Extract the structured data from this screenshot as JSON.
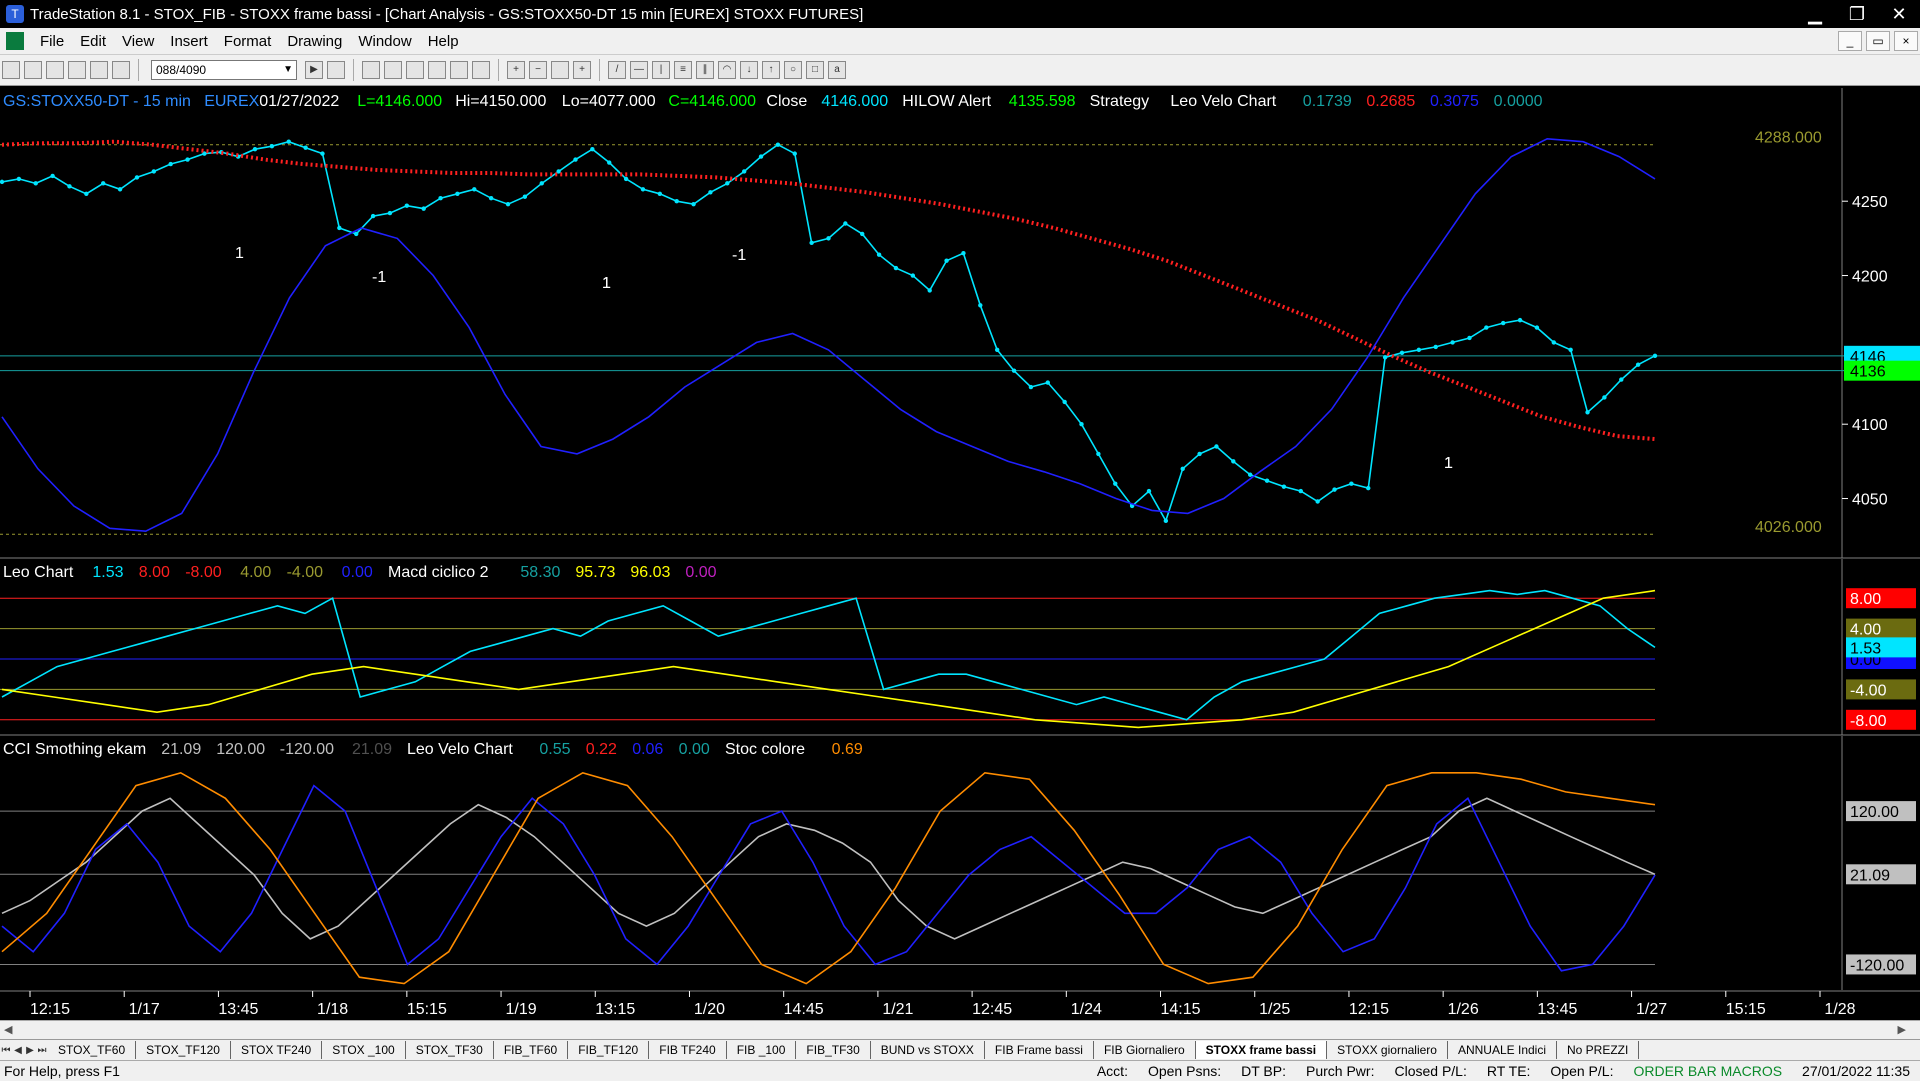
{
  "window": {
    "title": "TradeStation 8.1 - STOX_FIB - STOXX frame bassi - [Chart Analysis - GS:STOXX50-DT  15 min  [EUREX] STOXX FUTURES]",
    "minimize": "▁",
    "restore": "❐",
    "close": "✕"
  },
  "menu": {
    "items": [
      "File",
      "Edit",
      "View",
      "Insert",
      "Format",
      "Drawing",
      "Window",
      "Help"
    ]
  },
  "toolbar": {
    "symbol_combo": "088/4090"
  },
  "chart_data": [
    {
      "type": "line",
      "panel": "price",
      "header": [
        {
          "text": "GS:STOXX50-DT - 15 min",
          "color": "#2f8cff"
        },
        {
          "text": "EUREX",
          "color": "#2f8cff"
        },
        {
          "text": "01/27/2022",
          "color": "#ffffff"
        },
        {
          "text": "L=4146.000",
          "color": "#00ff00"
        },
        {
          "text": "Hi=4150.000",
          "color": "#ffffff"
        },
        {
          "text": "Lo=4077.000",
          "color": "#ffffff"
        },
        {
          "text": "C=4146.000",
          "color": "#00ff00"
        },
        {
          "text": "Close",
          "color": "#ffffff"
        },
        {
          "text": "4146.000",
          "color": "#00e5ff"
        },
        {
          "text": "HILOW Alert",
          "color": "#ffffff"
        },
        {
          "text": "4135.598",
          "color": "#00ff00"
        },
        {
          "text": "Strategy",
          "color": "#ffffff"
        },
        {
          "text": "Leo Velo Chart",
          "color": "#ffffff"
        },
        {
          "text": "0.1739",
          "color": "#16a0a0"
        },
        {
          "text": "0.2685",
          "color": "#ff2020"
        },
        {
          "text": "0.3075",
          "color": "#2020ff"
        },
        {
          "text": "0.0000",
          "color": "#16a0a0"
        }
      ],
      "ylim": [
        4010,
        4310
      ],
      "y_ticks": [
        "4250",
        "4200",
        "4100",
        "4050"
      ],
      "levels": [
        {
          "label": "4288.000",
          "value": 4288,
          "color": "#9a9a30"
        },
        {
          "label": "4026.000",
          "value": 4026,
          "color": "#9a9a30"
        }
      ],
      "last_price_labels": [
        {
          "label": "4146",
          "value": 4146,
          "color": "#00e5ff"
        },
        {
          "label": "4136",
          "value": 4136,
          "color": "#00ff00"
        }
      ],
      "series": [
        {
          "name": "Close",
          "color": "#00e5ff",
          "values": [
            4263,
            4265,
            4262,
            4267,
            4260,
            4255,
            4262,
            4258,
            4266,
            4270,
            4275,
            4278,
            4282,
            4283,
            4280,
            4285,
            4287,
            4290,
            4286,
            4282,
            4232,
            4228,
            4240,
            4242,
            4247,
            4245,
            4252,
            4255,
            4258,
            4252,
            4248,
            4253,
            4262,
            4270,
            4278,
            4285,
            4276,
            4265,
            4258,
            4255,
            4250,
            4248,
            4256,
            4262,
            4270,
            4280,
            4288,
            4282,
            4222,
            4225,
            4235,
            4228,
            4214,
            4205,
            4200,
            4190,
            4210,
            4215,
            4180,
            4150,
            4136,
            4125,
            4128,
            4115,
            4100,
            4080,
            4060,
            4045,
            4055,
            4035,
            4070,
            4080,
            4085,
            4075,
            4066,
            4062,
            4058,
            4055,
            4048,
            4056,
            4060,
            4057,
            4145,
            4148,
            4150,
            4152,
            4155,
            4158,
            4165,
            4168,
            4170,
            4165,
            4155,
            4150,
            4108,
            4118,
            4130,
            4140,
            4146
          ]
        },
        {
          "name": "HILOW Alert",
          "color": "#ff2020",
          "values": [
            4288,
            4289,
            4289,
            4290,
            4288,
            4285,
            4282,
            4278,
            4275,
            4273,
            4271,
            4270,
            4269,
            4269,
            4268,
            4268,
            4268,
            4268,
            4267,
            4266,
            4264,
            4262,
            4259,
            4256,
            4252,
            4248,
            4243,
            4238,
            4232,
            4225,
            4218,
            4210,
            4200,
            4190,
            4180,
            4170,
            4158,
            4146,
            4135,
            4125,
            4115,
            4105,
            4098,
            4092,
            4090
          ]
        },
        {
          "name": "Leo Velo Chart",
          "color": "#2020ff",
          "values": [
            4105,
            4070,
            4045,
            4030,
            4028,
            4040,
            4080,
            4135,
            4185,
            4220,
            4232,
            4225,
            4200,
            4165,
            4120,
            4085,
            4080,
            4090,
            4105,
            4125,
            4140,
            4155,
            4161,
            4150,
            4130,
            4110,
            4095,
            4085,
            4075,
            4068,
            4060,
            4050,
            4042,
            4040,
            4050,
            4068,
            4085,
            4110,
            4145,
            4185,
            4220,
            4255,
            4280,
            4292,
            4290,
            4280,
            4265
          ]
        }
      ]
    },
    {
      "type": "line",
      "panel": "oscillator",
      "header": [
        {
          "text": "Leo Chart",
          "color": "#ffffff"
        },
        {
          "text": "1.53",
          "color": "#00e5ff"
        },
        {
          "text": "8.00",
          "color": "#ff2020"
        },
        {
          "text": "-8.00",
          "color": "#ff2020"
        },
        {
          "text": "4.00",
          "color": "#9a9a30"
        },
        {
          "text": "-4.00",
          "color": "#9a9a30"
        },
        {
          "text": "0.00",
          "color": "#2020ff"
        },
        {
          "text": "Macd ciclico 2",
          "color": "#ffffff"
        },
        {
          "text": "58.30",
          "color": "#16a0a0"
        },
        {
          "text": "95.73",
          "color": "#ffff00"
        },
        {
          "text": "96.03",
          "color": "#ffff00"
        },
        {
          "text": "0.00",
          "color": "#c020c0"
        }
      ],
      "ylim": [
        -10,
        10
      ],
      "levels": [
        {
          "label": "8.00",
          "value": 8,
          "color": "#ff2020",
          "box": "#ff0000",
          "text": "#ffffff"
        },
        {
          "label": "4.00",
          "value": 4,
          "color": "#9a9a30",
          "box": "#6b6b10",
          "text": "#ffffff"
        },
        {
          "label": "0.00",
          "value": 0,
          "color": "#2020ff",
          "box": "#1010ff",
          "text": "#000000"
        },
        {
          "label": "-4.00",
          "value": -4,
          "color": "#9a9a30",
          "box": "#6b6b10",
          "text": "#ffffff"
        },
        {
          "label": "-8.00",
          "value": -8,
          "color": "#ff2020",
          "box": "#ff0000",
          "text": "#ffffff"
        }
      ],
      "last_value_label": {
        "label": "1.53",
        "value": 1.53,
        "color": "#00e5ff"
      },
      "series": [
        {
          "name": "Leo Chart",
          "color": "#00e5ff",
          "values": [
            -5,
            -3,
            -1,
            0,
            1,
            2,
            3,
            4,
            5,
            6,
            7,
            6,
            8,
            -5,
            -4,
            -3,
            -1,
            1,
            2,
            3,
            4,
            3,
            5,
            6,
            7,
            5,
            3,
            4,
            5,
            6,
            7,
            8,
            -4,
            -3,
            -2,
            -2,
            -3,
            -4,
            -5,
            -6,
            -5,
            -6,
            -7,
            -8,
            -5,
            -3,
            -2,
            -1,
            0,
            3,
            6,
            7,
            8,
            8.5,
            9,
            8.5,
            9,
            8,
            7,
            4,
            1.53
          ]
        },
        {
          "name": "Macd ciclico 2",
          "color": "#ffff00",
          "values": [
            -4,
            -5,
            -6,
            -7,
            -6,
            -4,
            -2,
            -1,
            -2,
            -3,
            -4,
            -3,
            -2,
            -1,
            -2,
            -3,
            -4,
            -5,
            -6,
            -7,
            -8,
            -8.5,
            -9,
            -8.5,
            -8,
            -7,
            -5,
            -3,
            -1,
            2,
            5,
            8,
            9
          ]
        }
      ]
    },
    {
      "type": "line",
      "panel": "cci",
      "header": [
        {
          "text": "CCI Smothing ekam",
          "color": "#ffffff"
        },
        {
          "text": "21.09",
          "color": "#c0c0c0"
        },
        {
          "text": "120.00",
          "color": "#c0c0c0"
        },
        {
          "text": "-120.00",
          "color": "#c0c0c0"
        },
        {
          "text": "21.09",
          "color": "#505050"
        },
        {
          "text": "Leo Velo Chart",
          "color": "#ffffff"
        },
        {
          "text": "0.55",
          "color": "#16a0a0"
        },
        {
          "text": "0.22",
          "color": "#ff2020"
        },
        {
          "text": "0.06",
          "color": "#2020ff"
        },
        {
          "text": "0.00",
          "color": "#16a0a0"
        },
        {
          "text": "Stoc colore",
          "color": "#ffffff"
        },
        {
          "text": "0.69",
          "color": "#ff8c00"
        }
      ],
      "ylim": [
        -160,
        200
      ],
      "levels": [
        {
          "label": "120.00",
          "value": 120,
          "color": "#808080",
          "box": "#c0c0c0"
        },
        {
          "label": "21.09",
          "value": 21.09,
          "color": "#808080",
          "box": "#c0c0c0"
        },
        {
          "label": "-120.00",
          "value": -120,
          "color": "#808080",
          "box": "#c0c0c0"
        }
      ],
      "series": [
        {
          "name": "CCI Smothing ekam",
          "color": "#c0c0c0",
          "values": [
            -40,
            -20,
            10,
            40,
            80,
            120,
            140,
            100,
            60,
            20,
            -40,
            -80,
            -60,
            -20,
            20,
            60,
            100,
            130,
            110,
            80,
            40,
            0,
            -40,
            -60,
            -40,
            0,
            40,
            80,
            100,
            90,
            70,
            40,
            -20,
            -60,
            -80,
            -60,
            -40,
            -20,
            0,
            20,
            40,
            30,
            10,
            -10,
            -30,
            -40,
            -20,
            0,
            20,
            40,
            60,
            80,
            120,
            140,
            120,
            100,
            80,
            60,
            40,
            21.09
          ]
        },
        {
          "name": "Leo Velo Chart",
          "color": "#2020ff",
          "values": [
            -60,
            -100,
            -40,
            60,
            100,
            40,
            -60,
            -100,
            -40,
            60,
            160,
            120,
            0,
            -120,
            -80,
            0,
            80,
            140,
            100,
            20,
            -80,
            -120,
            -60,
            20,
            100,
            120,
            40,
            -60,
            -120,
            -100,
            -40,
            20,
            60,
            80,
            40,
            0,
            -40,
            -40,
            0,
            60,
            80,
            40,
            -40,
            -100,
            -80,
            0,
            100,
            140,
            40,
            -60,
            -130,
            -120,
            -60,
            20
          ]
        },
        {
          "name": "Stoc colore",
          "color": "#ff8c00",
          "values": [
            -100,
            -40,
            60,
            160,
            180,
            140,
            60,
            -40,
            -140,
            -150,
            -100,
            20,
            140,
            180,
            160,
            80,
            -20,
            -120,
            -150,
            -100,
            0,
            120,
            180,
            170,
            90,
            -10,
            -120,
            -150,
            -140,
            -60,
            60,
            160,
            180,
            180,
            170,
            150,
            140,
            130
          ]
        }
      ]
    }
  ],
  "x_axis": {
    "ticks": [
      "12:15",
      "1/17",
      "13:45",
      "1/18",
      "15:15",
      "1/19",
      "13:15",
      "1/20",
      "14:45",
      "1/21",
      "12:45",
      "1/24",
      "14:15",
      "1/25",
      "12:15",
      "1/26",
      "13:45",
      "1/27",
      "15:15",
      "1/28"
    ]
  },
  "annotations": {
    "price_signals": [
      "1",
      "-1",
      "1",
      "-1",
      "1",
      "1",
      "1"
    ]
  },
  "tabs": {
    "items": [
      "STOX_TF60",
      "STOX_TF120",
      "STOX TF240",
      "STOX _100",
      "STOX_TF30",
      "FIB_TF60",
      "FIB_TF120",
      "FIB TF240",
      "FIB _100",
      "FIB_TF30",
      "BUND vs STOXX",
      "FIB Frame bassi",
      "FIB Giornaliero",
      "STOXX frame bassi",
      "STOXX giornaliero",
      "ANNUALE Indici",
      "No PREZZI"
    ],
    "active": "STOXX frame bassi"
  },
  "status": {
    "help": "For Help, press F1",
    "fields": [
      "Acct:",
      "Open Psns:",
      "DT BP:",
      "Purch Pwr:",
      "Closed P/L:",
      "RT TE:",
      "Open P/L:"
    ],
    "macros": "ORDER BAR MACROS",
    "datetime": "27/01/2022 11:35"
  }
}
